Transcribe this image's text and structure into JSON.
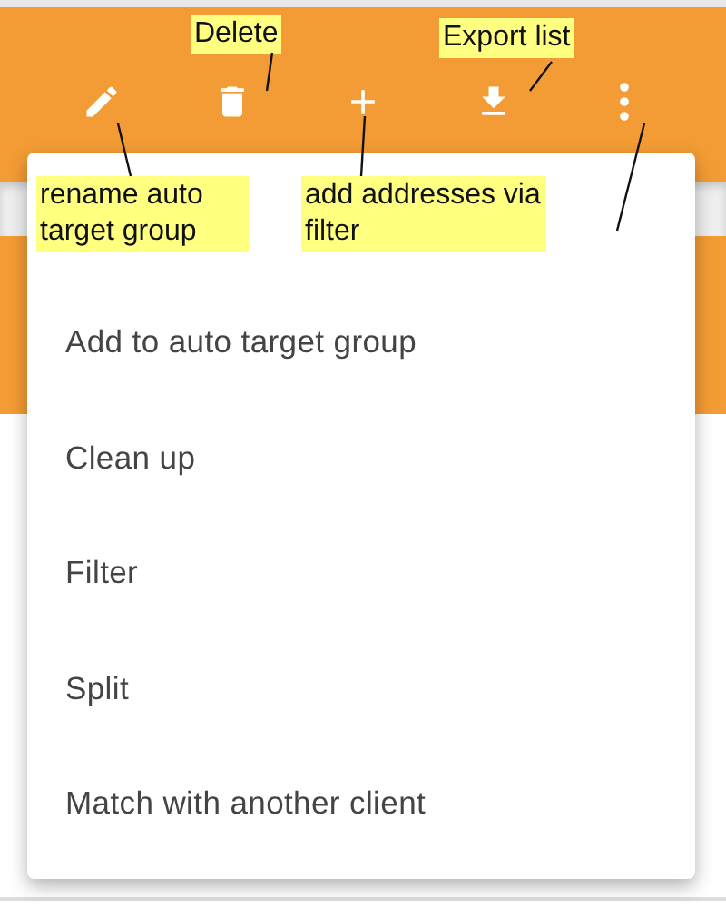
{
  "callouts": [
    {
      "text": "Delete"
    },
    {
      "text": "Export list"
    },
    {
      "text": "rename auto target group"
    },
    {
      "text": "add addresses via filter"
    }
  ],
  "menu": {
    "items": [
      {
        "label": "Add to auto target group"
      },
      {
        "label": "Clean up"
      },
      {
        "label": "Filter"
      },
      {
        "label": "Split"
      },
      {
        "label": "Match with another client"
      }
    ]
  }
}
